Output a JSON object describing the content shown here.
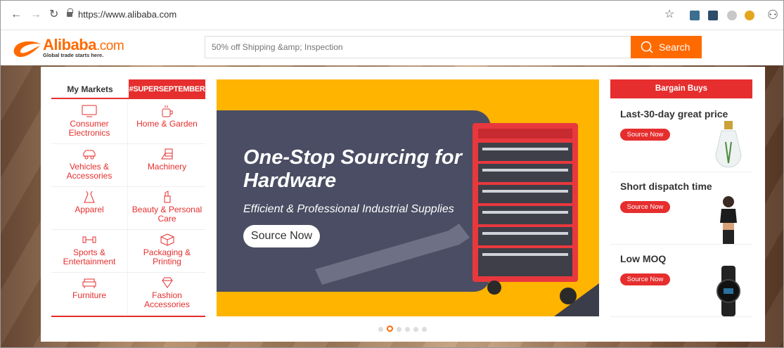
{
  "browser": {
    "url": "https://www.alibaba.com"
  },
  "header": {
    "logo_word": "Alibaba",
    "logo_com": ".com",
    "tagline": "Global trade starts here.",
    "search_placeholder": "50% off Shipping &amp; Inspection",
    "search_label": "Search"
  },
  "markets": {
    "tab_my": "My Markets",
    "tab_promo": "#SUPERSEPTEMBER",
    "items": [
      {
        "label": "Consumer Electronics",
        "icon": "tv-icon"
      },
      {
        "label": "Home & Garden",
        "icon": "mug-icon"
      },
      {
        "label": "Vehicles & Accessories",
        "icon": "car-icon"
      },
      {
        "label": "Machinery",
        "icon": "machine-icon"
      },
      {
        "label": "Apparel",
        "icon": "dress-icon"
      },
      {
        "label": "Beauty & Personal Care",
        "icon": "lipstick-icon"
      },
      {
        "label": "Sports & Entertainment",
        "icon": "dumbbell-icon"
      },
      {
        "label": "Packaging & Printing",
        "icon": "box-icon"
      },
      {
        "label": "Furniture",
        "icon": "sofa-icon"
      },
      {
        "label": "Fashion Accessories",
        "icon": "diamond-icon"
      }
    ]
  },
  "banner": {
    "title": "One-Stop Sourcing for Hardware",
    "subtitle": "Efficient & Professional Industrial Supplies",
    "button": "Source Now",
    "slide_count": 6,
    "active_slide": 2
  },
  "bargain": {
    "title": "Bargain Buys",
    "deals": [
      {
        "title": "Last-30-day great price",
        "button": "Source Now",
        "image": "lightbulb-image"
      },
      {
        "title": "Short dispatch time",
        "button": "Source Now",
        "image": "woman-image"
      },
      {
        "title": "Low MOQ",
        "button": "Source Now",
        "image": "watch-image"
      }
    ]
  },
  "colors": {
    "brand_orange": "#ff6a00",
    "accent_red": "#e62e2e",
    "banner_yellow": "#ffb400"
  }
}
